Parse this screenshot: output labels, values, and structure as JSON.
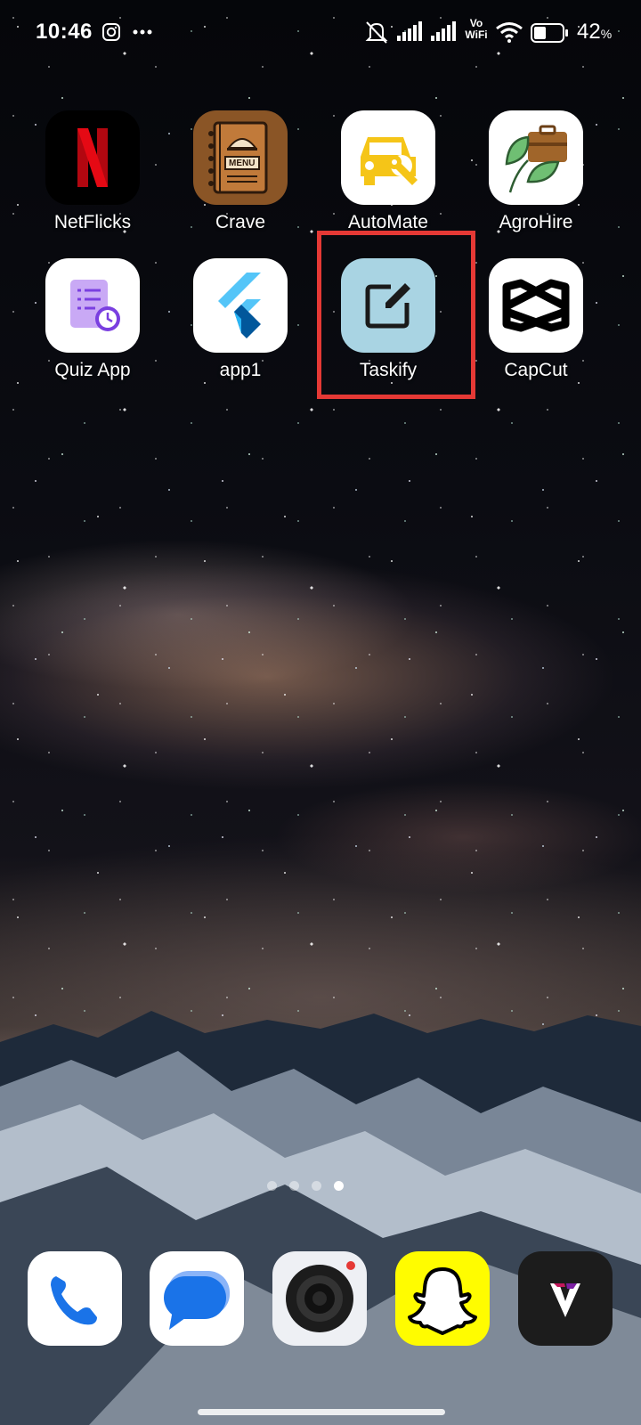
{
  "status_bar": {
    "time": "10:46",
    "battery_percent": "42",
    "battery_unit": "%",
    "icons": [
      "instagram-icon",
      "more-dots-icon",
      "mute-icon",
      "signal-1-icon",
      "signal-2-icon",
      "vowifi-icon",
      "wifi-icon",
      "battery-icon"
    ],
    "vowifi_text_top": "Vo",
    "vowifi_text_bottom": "WiFi"
  },
  "apps_row1": [
    {
      "label": "NetFlicks",
      "icon": "netflix-icon"
    },
    {
      "label": "Crave",
      "icon": "menu-book-icon"
    },
    {
      "label": "AutoMate",
      "icon": "car-wrench-icon"
    },
    {
      "label": "AgroHire",
      "icon": "leaf-briefcase-icon"
    }
  ],
  "apps_row2": [
    {
      "label": "Quiz App",
      "icon": "quiz-clipboard-icon"
    },
    {
      "label": "app1",
      "icon": "flutter-icon"
    },
    {
      "label": "Taskify",
      "icon": "edit-square-icon"
    },
    {
      "label": "CapCut",
      "icon": "capcut-icon"
    }
  ],
  "crave_menu_text": "MENU",
  "netflix_letter": "N",
  "page_indicator": {
    "total": 4,
    "active": 4
  },
  "dock": [
    {
      "name": "phone",
      "icon": "phone-icon"
    },
    {
      "name": "messages",
      "icon": "message-bubble-icon"
    },
    {
      "name": "camera",
      "icon": "camera-icon"
    },
    {
      "name": "snapchat",
      "icon": "snapchat-ghost-icon"
    },
    {
      "name": "v-app",
      "icon": "v-logo-icon"
    }
  ],
  "colors": {
    "highlight": "#e53935",
    "taskify_bg": "#a9d4e3",
    "snapchat_bg": "#fffc00"
  }
}
